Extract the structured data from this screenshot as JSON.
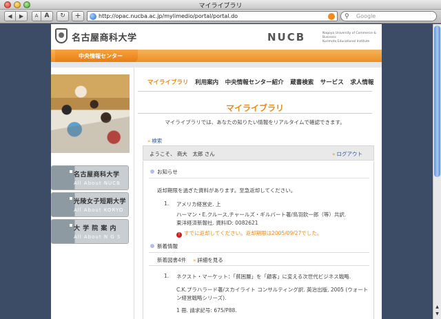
{
  "window": {
    "title": "マイライブラリ"
  },
  "toolbar": {
    "back": "◀",
    "forward": "▶",
    "font_small": "A",
    "font_big": "A",
    "reload": "↻",
    "add": "+",
    "url": "http://opac.nucba.ac.jp/mylimedio/portal/portal.do",
    "search_placeholder": "Google"
  },
  "header": {
    "school_name": "名古屋商科大学",
    "brand": "NUCB",
    "brand_sub_1": "Nagoya University of Commerce & Business",
    "brand_sub_2": "Kurimoto Educational Institute",
    "section_tab": "中央情報センター"
  },
  "sidebar": {
    "links": [
      {
        "jp": "名古屋商科大学",
        "en": "All About NUCB"
      },
      {
        "jp": "光陵女子短期大学",
        "en": "All About KORYO"
      },
      {
        "jp": "大 学 院 案 内",
        "en": "All About N G S"
      }
    ]
  },
  "nav": {
    "items": [
      "マイライブラリ",
      "利用案内",
      "中央情報センター紹介",
      "蔵書検索",
      "サービス",
      "求人情報"
    ],
    "active_index": 0
  },
  "main": {
    "title": "マイライブラリ",
    "description": "マイライブラリでは、あなたの知りたい情報をリアルタイムで確認できます。",
    "search_link": "検索",
    "welcome": "ようこそ、 商大　太郎 さん",
    "logout": "ログアウト"
  },
  "notices": {
    "heading": "お知らせ",
    "message": "返却期限を過ぎた資料があります。至急返却してください。",
    "items": [
      {
        "number": "1.",
        "title": "アメリカ経営史. 上",
        "authors": "ハーマン・E.クルース,チャールズ・ギルバート著/鳥羽欽一郎（等）共訳.",
        "publisher": "東洋経済新報社. 資料ID: 0082621",
        "warning": "すでに返却してください。返却期限は2005/09/27でした。"
      }
    ]
  },
  "new_books": {
    "heading": "新着情報",
    "count_label": "新着図書4件",
    "more_link": "詳細を見る",
    "items": [
      {
        "number": "1.",
        "title": "ネクスト・マーケット：「貧困層」を「顧客」に変える次世代ビジネス戦略.",
        "author_line_1": "C.K.プラハラード著/スカイライト コンサルティング訳. 英治出版, 2005 (ウォート",
        "author_line_2": "ン経営戦略シリーズ).",
        "call_no": "1 冊. 請求記号: 675/P88."
      }
    ]
  },
  "colors": {
    "accent": "#e88a1a",
    "link": "#2c5aa0",
    "background": "#3d4c66"
  }
}
